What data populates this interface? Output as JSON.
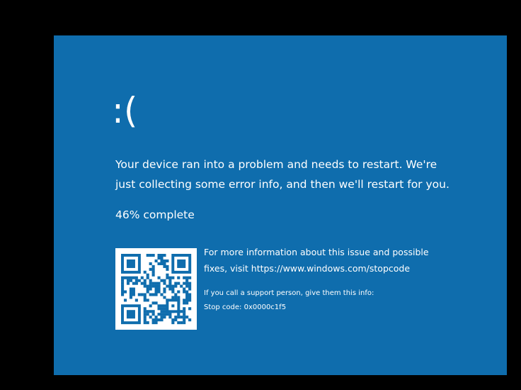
{
  "screen": {
    "background": "#0f6dad",
    "text_color": "#ffffff",
    "frame_color": "#000000"
  },
  "sad_face": ":(",
  "message": {
    "line1": "Your device ran into a problem and needs to restart. We're",
    "line2": "just collecting some error info, and then we'll restart for you."
  },
  "progress": {
    "percent": 46,
    "text": "46% complete"
  },
  "qr_code": {
    "icon": "qr-code-icon",
    "background": "#ffffff",
    "module_color": "#0f6dad"
  },
  "info": {
    "more_line1": "For more information about this issue and possible",
    "more_line2": "fixes, visit https://www.windows.com/stopcode",
    "support_line": "If you call a support person, give them this info:",
    "stop_code": "Stop code: 0x0000c1f5"
  }
}
